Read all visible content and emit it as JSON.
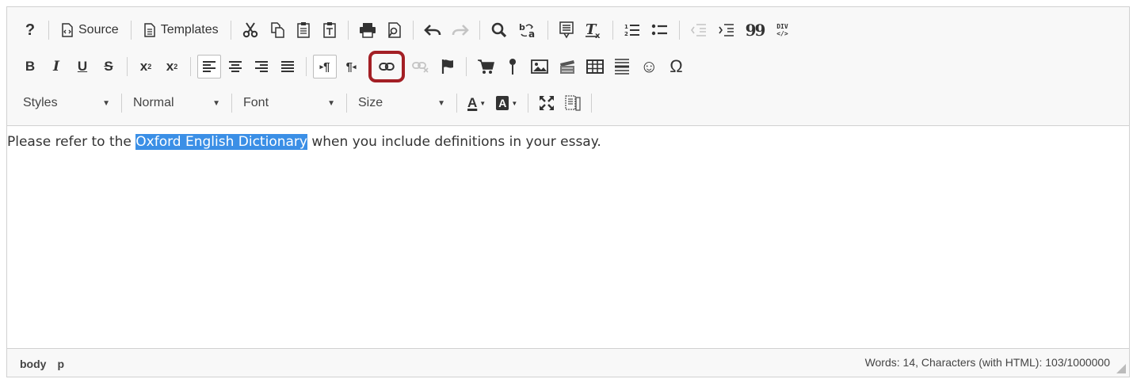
{
  "toolbar": {
    "row1": {
      "help": "?",
      "source": "Source",
      "templates": "Templates",
      "blockquote": "99",
      "div_top": "DIV",
      "div_bottom": "</>"
    },
    "row2": {
      "bold": "B",
      "italic": "I",
      "underline": "U",
      "strike": "S",
      "subscript_x": "x",
      "subscript_n": "2",
      "superscript_x": "x",
      "superscript_n": "2",
      "ltr": "¶",
      "rtl": "¶",
      "smiley": "☺",
      "omega": "Ω"
    },
    "row3": {
      "styles": "Styles",
      "format": "Normal",
      "font": "Font",
      "size": "Size",
      "text_color": "A",
      "bg_color": "A"
    },
    "colors": {
      "highlight_ring": "#a31f25",
      "selection": "#3b8fe6"
    }
  },
  "content": {
    "before": "Please refer to the ",
    "selected": "Oxford English Dictionary",
    "after": " when you include definitions in your essay."
  },
  "status": {
    "path": [
      "body",
      "p"
    ],
    "counts": "Words: 14, Characters (with HTML): 103/1000000"
  }
}
